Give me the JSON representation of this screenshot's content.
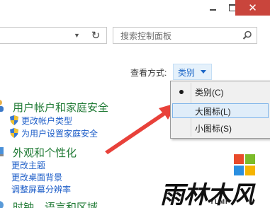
{
  "window": {
    "minimize_glyph": "",
    "maximize_glyph": "",
    "close_glyph": "✕"
  },
  "toolbar": {
    "dropdown_glyph": "▼",
    "refresh_glyph": "↻",
    "search_placeholder": "搜索控制面板"
  },
  "view_by": {
    "label": "查看方式:",
    "value": "类别"
  },
  "view_menu": {
    "items": [
      {
        "label": "类别(C)",
        "selected": true
      },
      {
        "label": "大图标(L)",
        "hovered": true
      },
      {
        "label": "小图标(S)"
      }
    ]
  },
  "categories": [
    {
      "title": "用户帐户和家庭安全",
      "links": [
        "更改帐户类型",
        "为用户设置家庭安全"
      ]
    },
    {
      "title": "外观和个性化",
      "links": [
        "更改主题",
        "更改桌面背景",
        "调整屏幕分辨率"
      ]
    },
    {
      "title": "时钟、语言和区域"
    }
  ],
  "watermark": {
    "text": "雨林木风",
    "sub": "YLMF"
  },
  "colors": {
    "close_button": "#c9453c",
    "category_title": "#1f7a34",
    "link": "#1e5ec8",
    "arrow": "#e8413a",
    "menu_hover": "#e0edf9"
  }
}
